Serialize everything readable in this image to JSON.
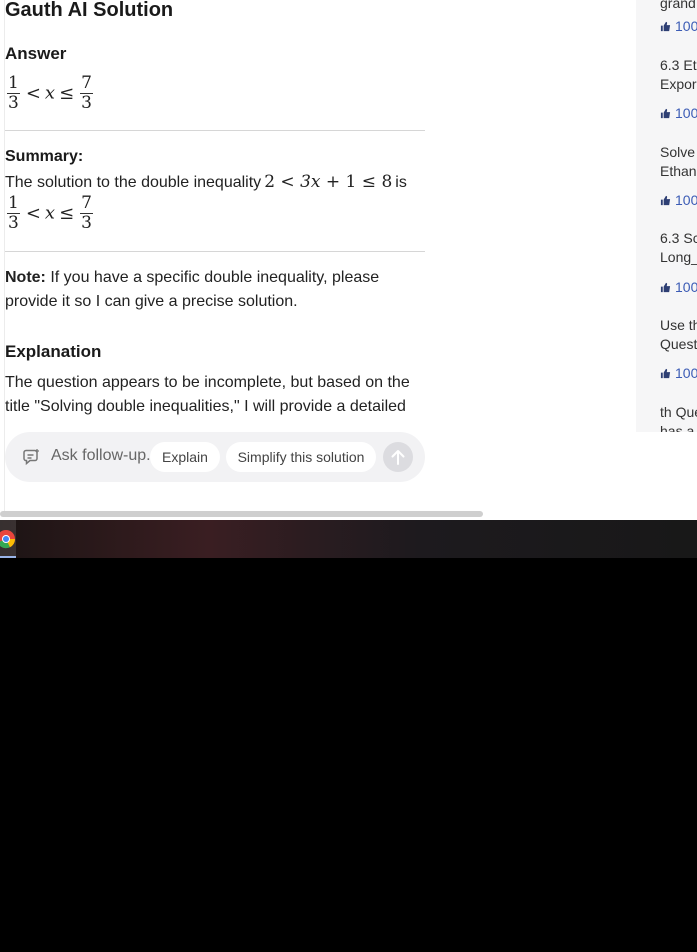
{
  "main": {
    "title": "Gauth AI Solution",
    "answer_heading": "Answer",
    "answer": {
      "num1": "1",
      "den1": "3",
      "lt": "<",
      "var": "x",
      "le": "≤",
      "num2": "7",
      "den2": "3"
    },
    "summary_heading": "Summary:",
    "summary_text_before": "The solution to the double inequality",
    "summary_inline": {
      "a": "2",
      "lt": "<",
      "expr": "3x",
      "plus": "+",
      "b": "1",
      "le": "≤",
      "c": "8"
    },
    "summary_text_after": "is",
    "summary_answer": {
      "num1": "1",
      "den1": "3",
      "lt": "<",
      "var": "x",
      "le": "≤",
      "num2": "7",
      "den2": "3"
    },
    "note_label": "Note:",
    "note_text": "If you have a specific double inequality, please provide it so I can give a precise solution.",
    "explanation_heading": "Explanation",
    "explanation_text": "The question appears to be incomplete, but based on the title \"Solving double inequalities,\" I will provide a detailed"
  },
  "followup": {
    "placeholder": "Ask follow-up...",
    "chips": [
      "Explain",
      "Simplify this solution"
    ]
  },
  "sidebar": {
    "items": [
      {
        "line1": "grand",
        "line2": "",
        "likes": "100"
      },
      {
        "line1": "6.3 Et",
        "line2": "Expor",
        "likes": "100"
      },
      {
        "line1": "Solve",
        "line2": "Ethan",
        "likes": "100"
      },
      {
        "line1": "6.3 Sc",
        "line2": "Long_",
        "likes": "100"
      },
      {
        "line1": "Use th",
        "line2": "Questi",
        "likes": "100"
      },
      {
        "line1": "th Que",
        "line2": "has a",
        "likes": ""
      }
    ]
  },
  "colors": {
    "accent": "#3b5bb5",
    "rule": "#d6d6d6",
    "pill": "#f2f2f4"
  }
}
